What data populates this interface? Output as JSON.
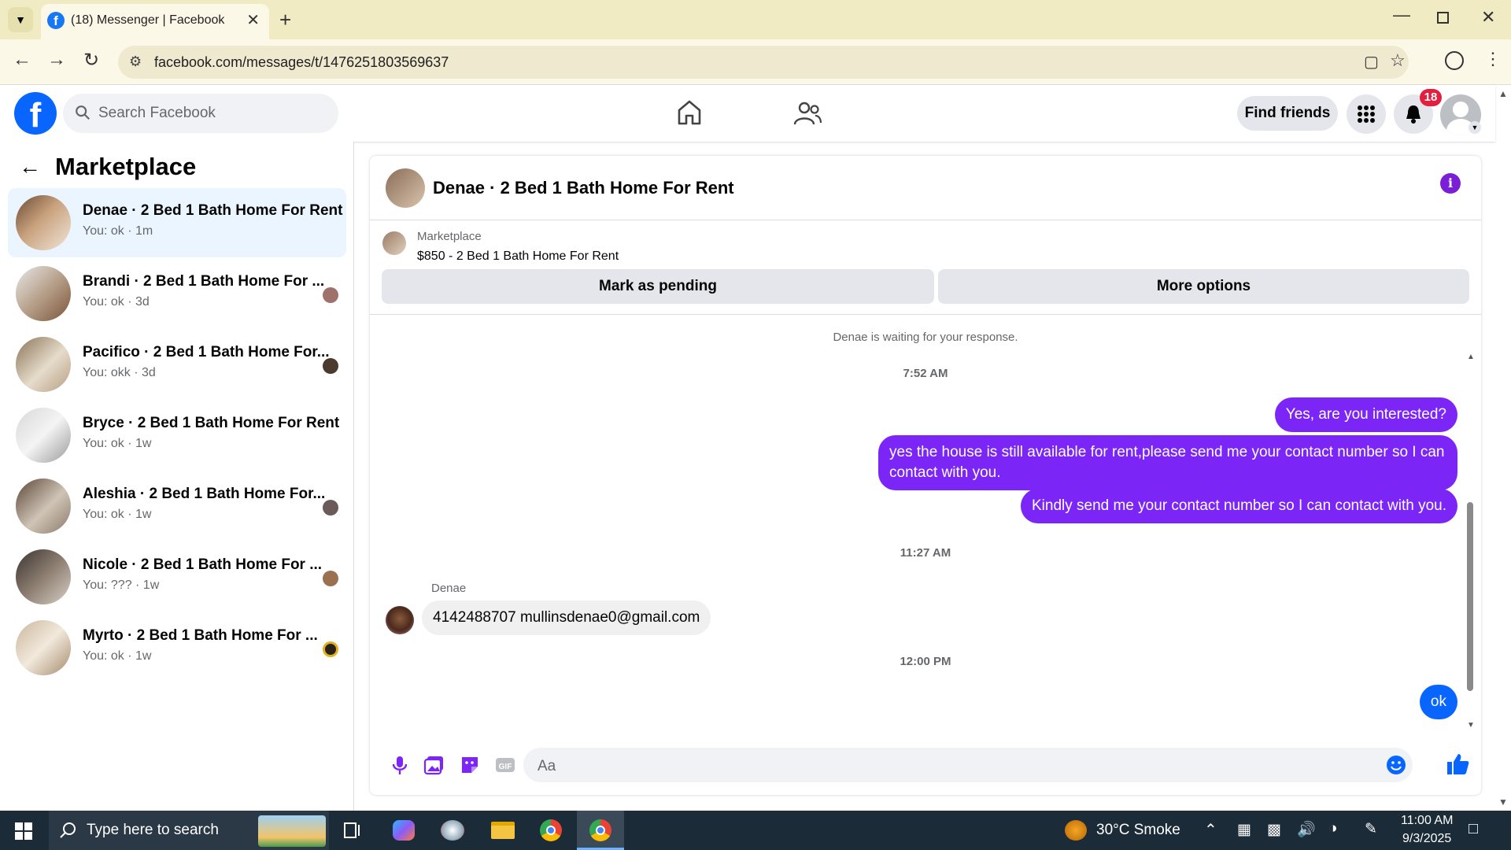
{
  "browser": {
    "tab_title": "(18) Messenger | Facebook",
    "url": "facebook.com/messages/t/1476251803569637"
  },
  "header": {
    "search_placeholder": "Search Facebook",
    "find_friends": "Find friends",
    "notification_count": "18"
  },
  "sidebar": {
    "title": "Marketplace",
    "conversations": [
      {
        "name": "Denae · 2 Bed 1 Bath Home For Rent",
        "preview": "You: ok · 1m",
        "selected": true
      },
      {
        "name": "Brandi · 2 Bed 1 Bath Home For ...",
        "preview": "You: ok · 3d"
      },
      {
        "name": "Pacifico · 2 Bed 1 Bath Home For...",
        "preview": "You: okk · 3d"
      },
      {
        "name": "Bryce · 2 Bed 1 Bath Home For Rent",
        "preview": "You: ok · 1w"
      },
      {
        "name": "Aleshia · 2 Bed 1 Bath Home For...",
        "preview": "You: ok · 1w"
      },
      {
        "name": "Nicole · 2 Bed 1 Bath Home For ...",
        "preview": "You: ??? · 1w"
      },
      {
        "name": "Myrto · 2 Bed 1 Bath Home For ...",
        "preview": "You: ok · 1w"
      }
    ]
  },
  "chat": {
    "title": "Denae · 2 Bed 1 Bath Home For Rent",
    "marketplace_label": "Marketplace",
    "listing": "$850 - 2 Bed 1 Bath Home For Rent",
    "mark_pending": "Mark as pending",
    "more_options": "More options",
    "waiting": "Denae is waiting for your response.",
    "time1": "7:52 AM",
    "out1": "Yes, are you interested?",
    "out2": "yes the house is still available for rent,please send me your contact number so I can contact with you.",
    "out3": "Kindly send me your contact number so I can contact with you.",
    "time2": "11:27 AM",
    "sender": "Denae",
    "in1": "4142488707 mullinsdenae0@gmail.com",
    "time3": "12:00 PM",
    "out4": "ok",
    "composer_placeholder": "Aa"
  },
  "taskbar": {
    "search_placeholder": "Type here to search",
    "weather": "30°C  Smoke",
    "time": "11:00 AM",
    "date": "9/3/2025"
  },
  "colors": {
    "accent": "#7b26f7",
    "fb_blue": "#0866ff",
    "selected_bg": "#ebf5ff"
  }
}
